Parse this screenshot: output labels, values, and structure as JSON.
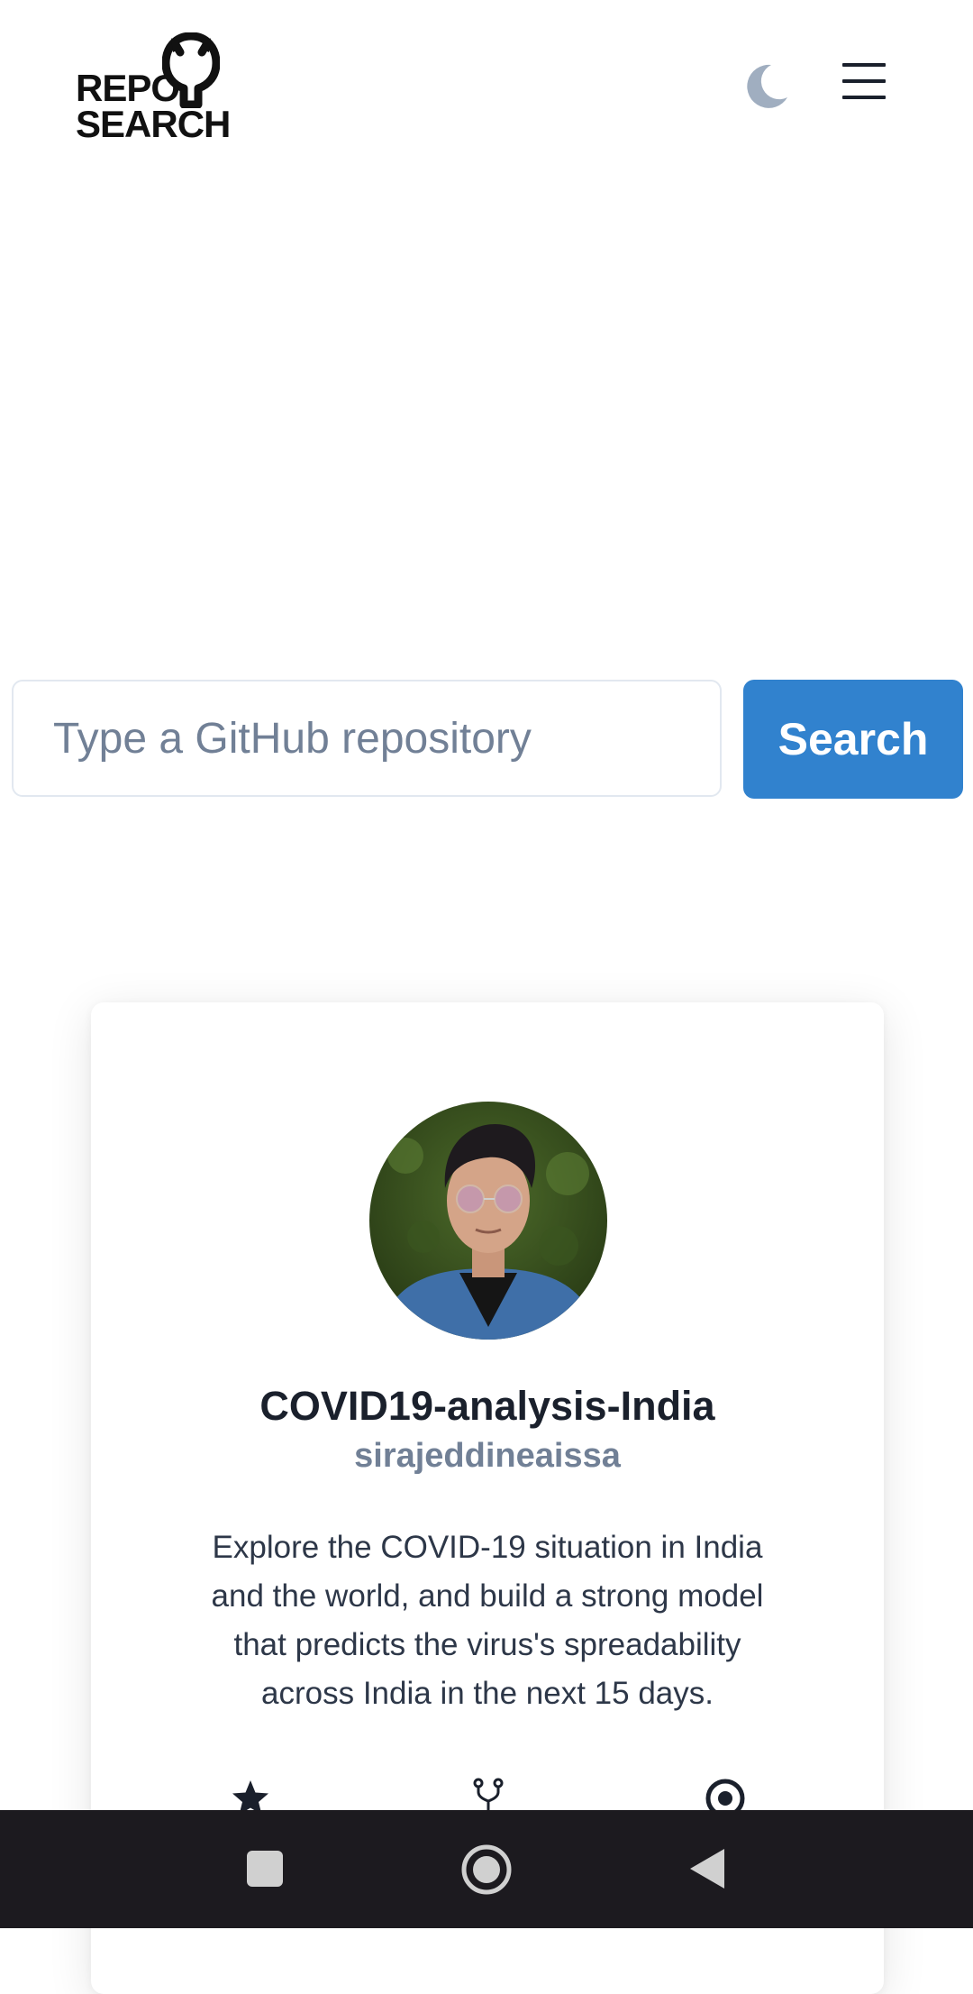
{
  "app": {
    "logo_line1": "REPO",
    "logo_line2": "SEARCH"
  },
  "search": {
    "placeholder": "Type a GitHub repository",
    "value": "",
    "button_label": "Search"
  },
  "repo_card": {
    "name": "COVID19-analysis-India",
    "owner": "sirajeddineaissa",
    "description": "Explore the COVID-19 situation in India and the world, and build a strong model that predicts the virus's spreadability across India in the next 15 days.",
    "stats_icons": [
      "star-icon",
      "fork-icon",
      "watch-icon"
    ]
  },
  "colors": {
    "accent": "#3182ce",
    "moon": "#a0aec0",
    "text_primary": "#1a202c",
    "text_muted": "#718096",
    "nav_bar": "#1c1a1f"
  },
  "icons": [
    "github-octocat-icon",
    "moon-icon",
    "hamburger-menu-icon",
    "nav-recents-icon",
    "nav-home-icon",
    "nav-back-icon"
  ]
}
